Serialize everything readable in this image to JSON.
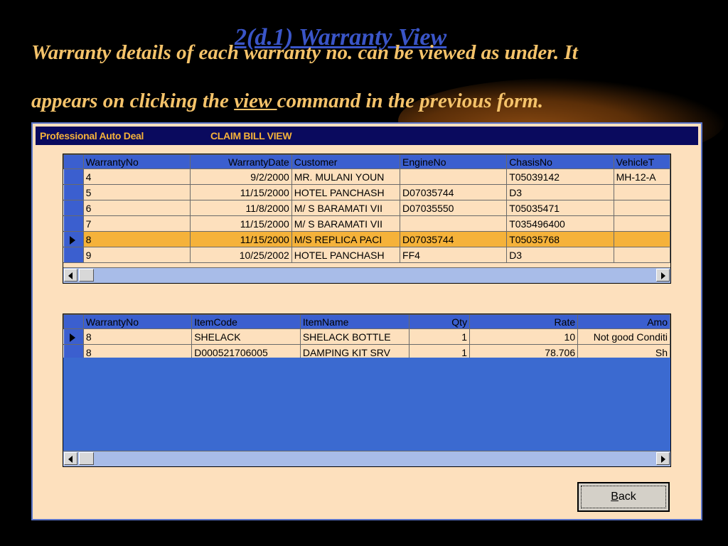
{
  "slide": {
    "title": "2(d.1) Warranty View",
    "intro_line1": "Warranty details of each warranty no. can be viewed as under. It",
    "intro_line2_pre": "appears on clicking the ",
    "intro_line2_link": "view ",
    "intro_line2_post": "command in the previous form."
  },
  "window": {
    "app_title": "Professional Auto Deal",
    "view_title": "CLAIM BILL VIEW"
  },
  "warranty_grid": {
    "columns": [
      "WarrantyNo",
      "WarrantyDate",
      "Customer",
      "EngineNo",
      "ChasisNo",
      "VehicleT"
    ],
    "rows": [
      {
        "no": "4",
        "date": "9/2/2000",
        "customer": "MR. MULANI YOUN",
        "engine": "",
        "chasis": "T05039142",
        "vehicle": "MH-12-A"
      },
      {
        "no": "5",
        "date": "11/15/2000",
        "customer": "HOTEL  PANCHASH",
        "engine": "D07035744",
        "chasis": "D3",
        "vehicle": ""
      },
      {
        "no": "6",
        "date": "11/8/2000",
        "customer": "M/ S BARAMATI VII",
        "engine": "D07035550",
        "chasis": "T05035471",
        "vehicle": ""
      },
      {
        "no": "7",
        "date": "11/15/2000",
        "customer": "M/ S BARAMATI VII",
        "engine": "",
        "chasis": "T035496400",
        "vehicle": ""
      },
      {
        "no": "8",
        "date": "11/15/2000",
        "customer": "M/S  REPLICA PACI",
        "engine": "D07035744",
        "chasis": "T05035768",
        "vehicle": ""
      },
      {
        "no": "9",
        "date": "10/25/2002",
        "customer": "HOTEL  PANCHASH",
        "engine": "FF4",
        "chasis": "D3",
        "vehicle": ""
      }
    ],
    "selected_row": 4
  },
  "item_grid": {
    "columns": [
      "WarrantyNo",
      "ItemCode",
      "ItemName",
      "Qty",
      "Rate",
      "Amo"
    ],
    "rows": [
      {
        "no": "8",
        "code": "SHELACK",
        "name": "SHELACK  BOTTLE",
        "qty": "1",
        "rate": "10",
        "amount": "Not good Conditi"
      },
      {
        "no": "8",
        "code": "D000521706005",
        "name": "DAMPING KIT SRV",
        "qty": "1",
        "rate": "78.706",
        "amount": "Sh"
      }
    ],
    "selected_row": 0
  },
  "back_button": {
    "label_underlined": "B",
    "label_rest": "ack"
  },
  "colors": {
    "highlight": "#f5b23a",
    "grid_blue": "#3b5fcf",
    "form_bg": "#fde0bd",
    "intro_text": "#f5c36a"
  }
}
